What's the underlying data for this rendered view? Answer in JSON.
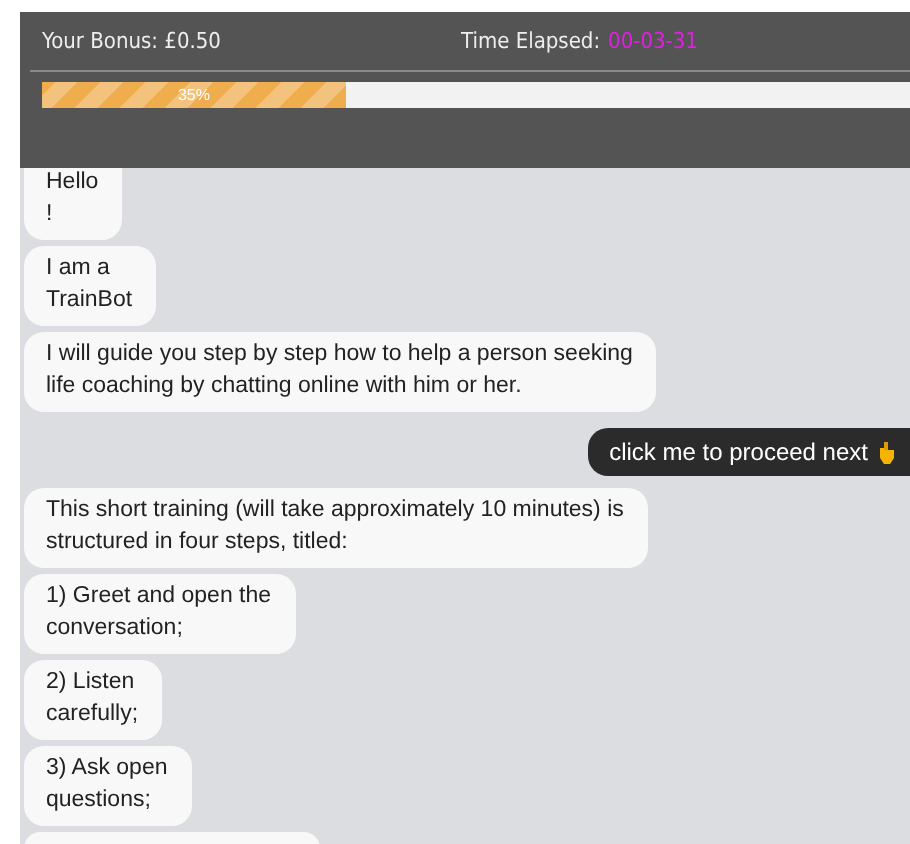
{
  "header": {
    "bonus_label": "Your Bonus:",
    "bonus_value": "£0.50",
    "time_label": "Time Elapsed:",
    "time_value": "00-03-31"
  },
  "progress": {
    "level": 0.35,
    "label": "35%"
  },
  "messages": [
    {
      "kind": "bot",
      "lines": [
        "Hello",
        "!"
      ]
    },
    {
      "kind": "bot",
      "lines": [
        "I am a",
        "TrainBot"
      ]
    },
    {
      "kind": "bot",
      "lines": [
        "I will guide you step by step how to help a person seeking",
        "life coaching by chatting online with him or her."
      ]
    },
    {
      "kind": "action",
      "lines": [
        "click me to proceed next"
      ]
    },
    {
      "kind": "bot",
      "lines": [
        "This short training (will take approximately 10 minutes) is",
        "structured in four steps, titled:"
      ]
    },
    {
      "kind": "bot",
      "lines": [
        "1) Greet and open the",
        "conversation;"
      ]
    },
    {
      "kind": "bot",
      "lines": [
        "2) Listen",
        "carefully;"
      ]
    },
    {
      "kind": "bot",
      "lines": [
        "3) Ask open",
        "questions;"
      ]
    },
    {
      "kind": "partial"
    }
  ]
}
